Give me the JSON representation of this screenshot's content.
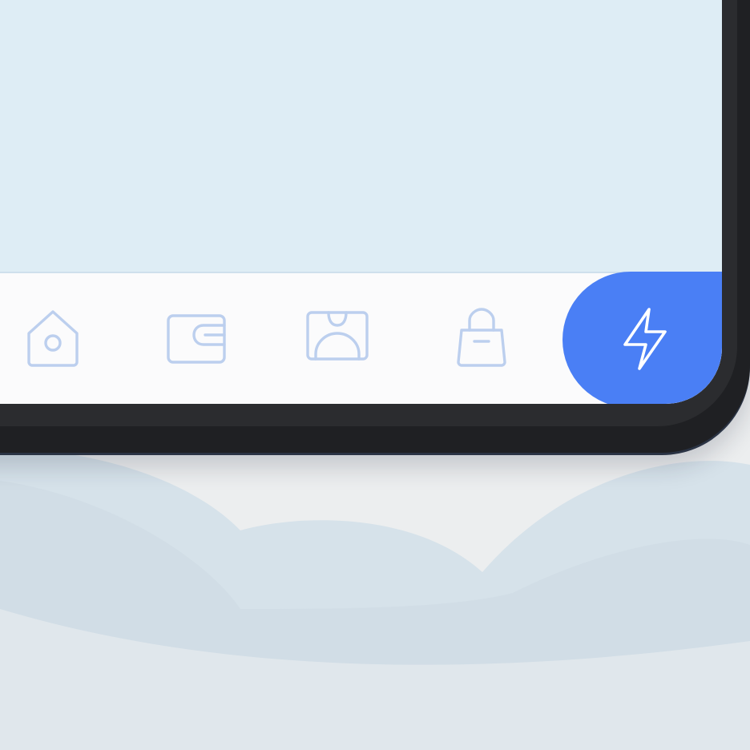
{
  "app": {
    "accent_color": "#4a7ff5",
    "inactive_icon_color": "#bccfee",
    "content_background": "#deedf5",
    "tab_bar_background": "#fbfbfc"
  },
  "tab_bar": {
    "active_index": 4,
    "tabs": [
      {
        "icon": "home-icon"
      },
      {
        "icon": "wallet-icon"
      },
      {
        "icon": "gallery-icon"
      },
      {
        "icon": "shopping-bag-icon"
      },
      {
        "icon": "lightning-icon"
      }
    ]
  }
}
